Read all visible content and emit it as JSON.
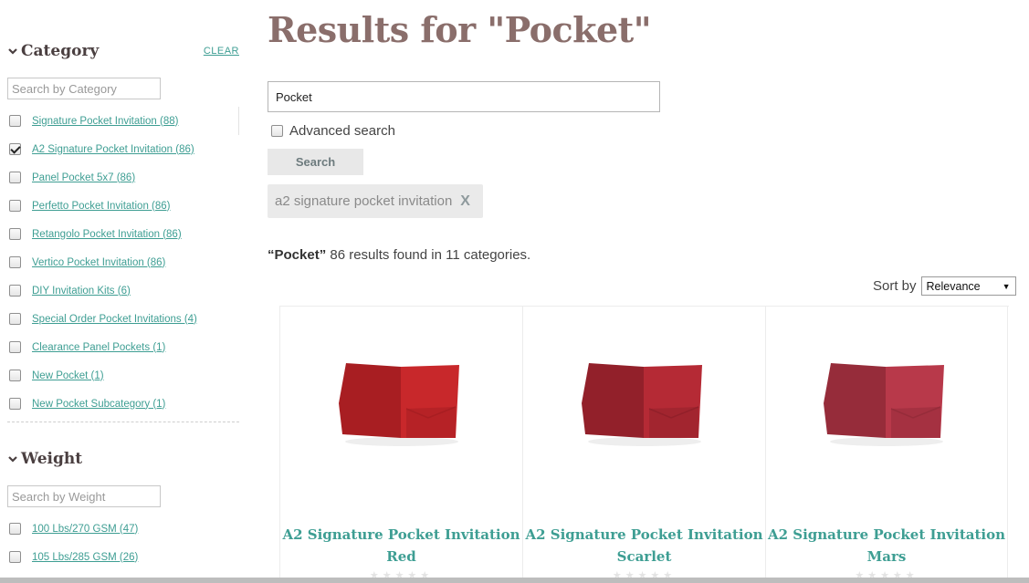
{
  "colors": {
    "accent": "#3e9e93",
    "title": "#8a6e6b"
  },
  "sidebar": {
    "category": {
      "title": "Category",
      "clear_label": "CLEAR",
      "search_placeholder": "Search by Category",
      "items": [
        {
          "label": "Signature Pocket Invitation (88)",
          "checked": false
        },
        {
          "label": "A2 Signature Pocket Invitation (86)",
          "checked": true
        },
        {
          "label": "Panel Pocket 5x7 (86)",
          "checked": false
        },
        {
          "label": "Perfetto Pocket Invitation (86)",
          "checked": false
        },
        {
          "label": "Retangolo Pocket Invitation (86)",
          "checked": false
        },
        {
          "label": "Vertico Pocket Invitation (86)",
          "checked": false
        },
        {
          "label": "DIY Invitation Kits (6)",
          "checked": false
        },
        {
          "label": "Special Order Pocket Invitations (4)",
          "checked": false
        },
        {
          "label": "Clearance Panel Pockets (1)",
          "checked": false
        },
        {
          "label": "New Pocket (1)",
          "checked": false
        },
        {
          "label": "New Pocket Subcategory (1)",
          "checked": false
        }
      ]
    },
    "weight": {
      "title": "Weight",
      "search_placeholder": "Search by Weight",
      "items": [
        {
          "label": "100 Lbs/270 GSM (47)",
          "checked": false
        },
        {
          "label": "105 Lbs/285 GSM (26)",
          "checked": false
        }
      ]
    }
  },
  "main": {
    "title": "Results for \"Pocket\"",
    "search_value": "Pocket",
    "advanced_label": "Advanced search",
    "search_button": "Search",
    "active_filter": {
      "label": "a2 signature pocket invitation",
      "remove": "X"
    },
    "summary": {
      "query": "“Pocket”",
      "text": " 86 results found in 11 categories."
    },
    "sort": {
      "label": "Sort by",
      "value": "Relevance"
    },
    "products": [
      {
        "name_line1": "A2 Signature Pocket Invitation",
        "name_line2": "Red",
        "color": "#c8282b",
        "shade": "#a81e22",
        "rating_stars": "★★★★★"
      },
      {
        "name_line1": "A2 Signature Pocket Invitation",
        "name_line2": "Scarlet",
        "color": "#b52a35",
        "shade": "#92202a",
        "rating_stars": "★★★★★"
      },
      {
        "name_line1": "A2 Signature Pocket Invitation",
        "name_line2": "Mars",
        "color": "#b8394a",
        "shade": "#962c3a",
        "rating_stars": "★★★★★"
      }
    ]
  }
}
